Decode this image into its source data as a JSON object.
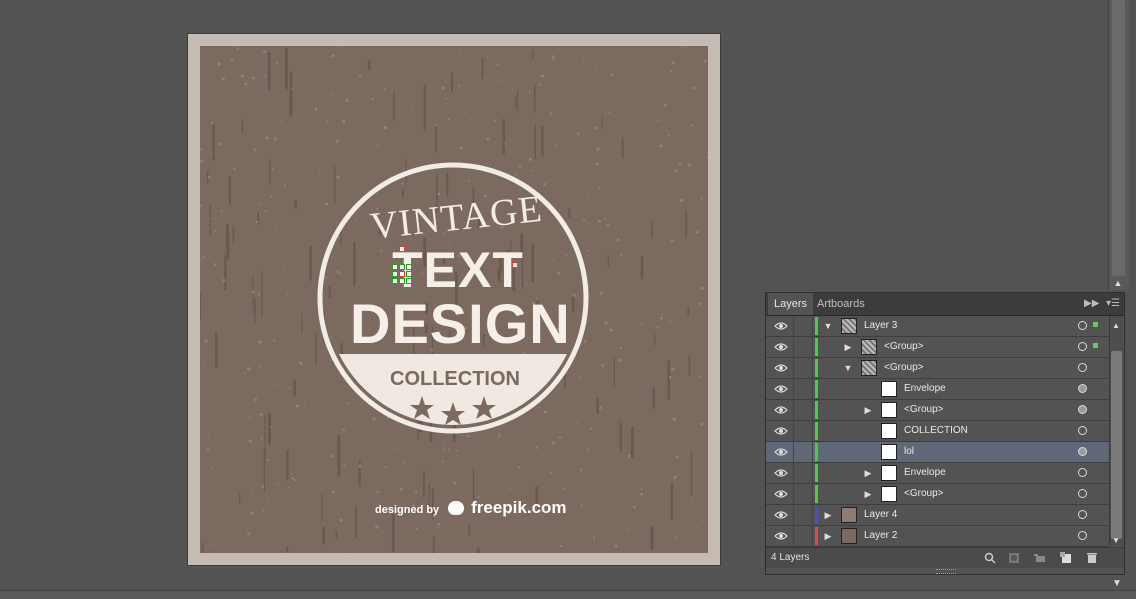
{
  "artwork": {
    "badge_word_1": "VINTAGE",
    "badge_word_2": "TEXT",
    "badge_word_3": "DESIGN",
    "badge_word_4": "COLLECTION",
    "credit_prefix": "designed by",
    "credit_brand": "freepik.com"
  },
  "colors": {
    "artwork_background": "#7c6a60",
    "frame": "#c4bcb3",
    "ui_background": "#535353",
    "selected_row": "#5f6877"
  },
  "layers_panel": {
    "tabs": [
      {
        "label": "Layers",
        "active": true
      },
      {
        "label": "Artboards",
        "active": false
      }
    ],
    "rows": [
      {
        "label": "Layer 3",
        "color": "#43d043",
        "expanded": true,
        "thumb": "textured",
        "targeted": false,
        "selection_indicator": true
      },
      {
        "label": "<Group>",
        "color": "#43d043",
        "expanded": false,
        "thumb": "textured",
        "targeted": false,
        "selection_indicator": true
      },
      {
        "label": "<Group>",
        "color": "#43d043",
        "expanded": true,
        "thumb": "textured",
        "targeted": false,
        "selection_indicator": false
      },
      {
        "label": "Envelope",
        "color": "#43d043",
        "expanded": null,
        "thumb": "white",
        "targeted": true,
        "selection_indicator": false
      },
      {
        "label": "<Group>",
        "color": "#43d043",
        "expanded": false,
        "thumb": "white",
        "targeted": true,
        "selection_indicator": false
      },
      {
        "label": "COLLECTION",
        "color": "#43d043",
        "expanded": null,
        "thumb": "white",
        "targeted": false,
        "selection_indicator": false
      },
      {
        "label": "lol",
        "color": "#43d043",
        "expanded": null,
        "thumb": "white",
        "targeted": true,
        "selected": true,
        "selection_indicator": false
      },
      {
        "label": "Envelope",
        "color": "#43d043",
        "expanded": false,
        "thumb": "white",
        "targeted": false,
        "selection_indicator": false
      },
      {
        "label": "<Group>",
        "color": "#43d043",
        "expanded": false,
        "thumb": "white",
        "targeted": false,
        "selection_indicator": false
      },
      {
        "label": "Layer 4",
        "color": "#4b4bd6",
        "expanded": false,
        "thumb": "tan",
        "targeted": false,
        "selection_indicator": false
      },
      {
        "label": "Layer 2",
        "color": "#e24848",
        "expanded": false,
        "thumb": "brown",
        "targeted": false,
        "selection_indicator": false
      }
    ],
    "footer": {
      "count_label": "4 Layers",
      "icons": [
        "locate-object-icon",
        "make-clipping-mask-icon",
        "create-sublayer-icon",
        "new-layer-icon",
        "delete-icon"
      ]
    }
  }
}
